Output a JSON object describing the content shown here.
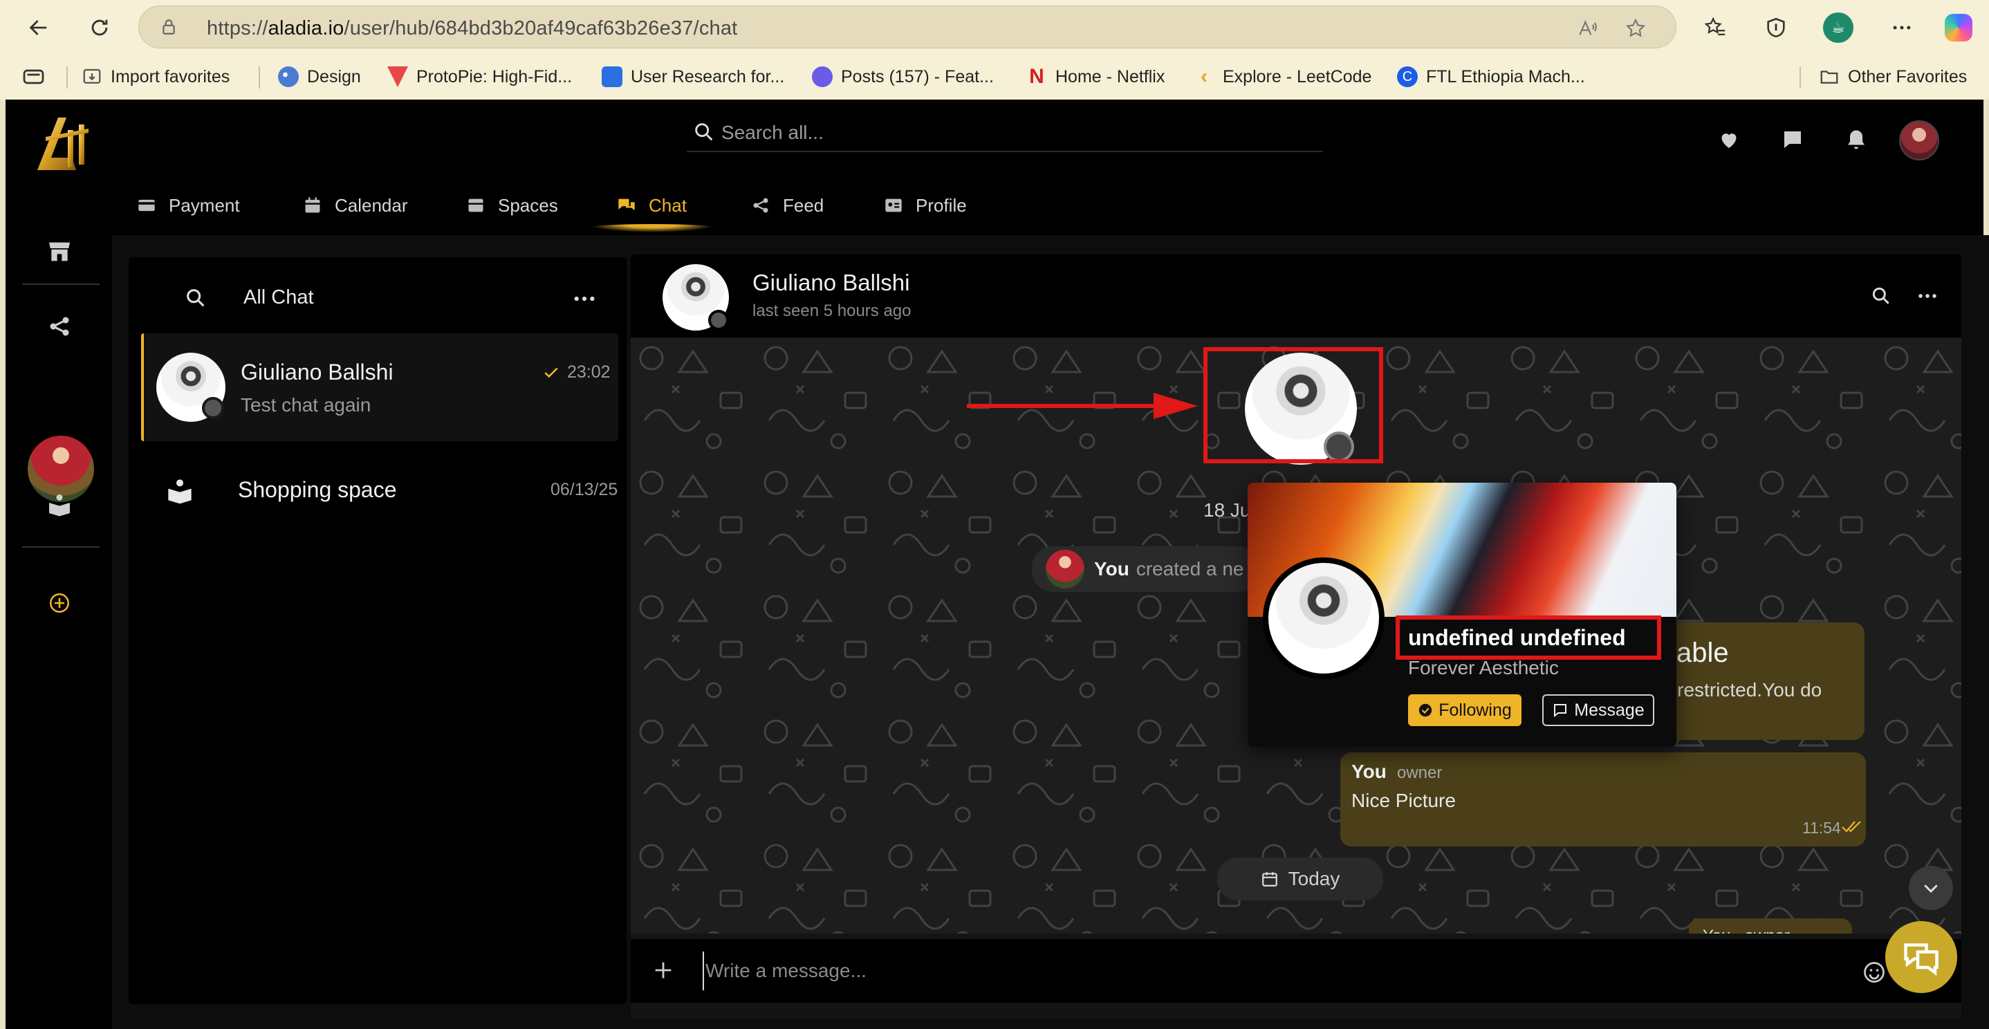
{
  "browser": {
    "url_prefix": "https://",
    "url_domain": "aladia.io",
    "url_path": "/user/hub/684bd3b20af49caf63b26e37/chat",
    "favorites": [
      {
        "label": "Import favorites",
        "color": "#555555"
      },
      {
        "label": "Design",
        "color": "#4a7bd0"
      },
      {
        "label": "ProtoPie: High-Fid...",
        "color": "#e8474a"
      },
      {
        "label": "User Research for...",
        "color": "#2b6fe0"
      },
      {
        "label": "Posts (157) - Feat...",
        "color": "#6a5be8"
      },
      {
        "label": "Home - Netflix",
        "color": "#d81f26"
      },
      {
        "label": "Explore - LeetCode",
        "color": "#f0a020"
      },
      {
        "label": "FTL Ethiopia Mach...",
        "color": "#1a5ee8"
      }
    ],
    "other_favorites": "Other Favorites"
  },
  "header": {
    "search_placeholder": "Search all..."
  },
  "tabs": [
    {
      "label": "Payment",
      "icon": "credit-card-icon"
    },
    {
      "label": "Calendar",
      "icon": "calendar-icon"
    },
    {
      "label": "Spaces",
      "icon": "spaces-icon"
    },
    {
      "label": "Chat",
      "icon": "chat-icon",
      "active": true
    },
    {
      "label": "Feed",
      "icon": "share-icon"
    },
    {
      "label": "Profile",
      "icon": "id-card-icon"
    }
  ],
  "chat_list": {
    "title": "All Chat",
    "items": [
      {
        "name": "Giuliano Ballshi",
        "preview": "Test chat again",
        "time": "23:02"
      },
      {
        "name": "Shopping space",
        "preview": "",
        "time": "06/13/25"
      }
    ]
  },
  "conversation": {
    "name": "Giuliano Ballshi",
    "status": "last seen 5 hours ago",
    "date_chip": "18 Ju",
    "system_you": "You",
    "system_text": "created a ne",
    "bubble1_title": "Available",
    "bubble1_text": "ate, or restricted.You do",
    "bubble2_you": "You",
    "bubble2_role": "owner",
    "bubble2_text": "Nice Picture",
    "bubble2_time": "11:54",
    "today_chip": "Today",
    "bubble3_peek": "You   owner",
    "composer_placeholder": "Write a message..."
  },
  "profile_popup": {
    "name": "undefined undefined",
    "bio": "Forever Aesthetic",
    "following_label": "Following",
    "message_label": "Message"
  },
  "colors": {
    "accent": "#f0b429",
    "annotation": "#e01818",
    "bubble": "#4a3f18"
  }
}
